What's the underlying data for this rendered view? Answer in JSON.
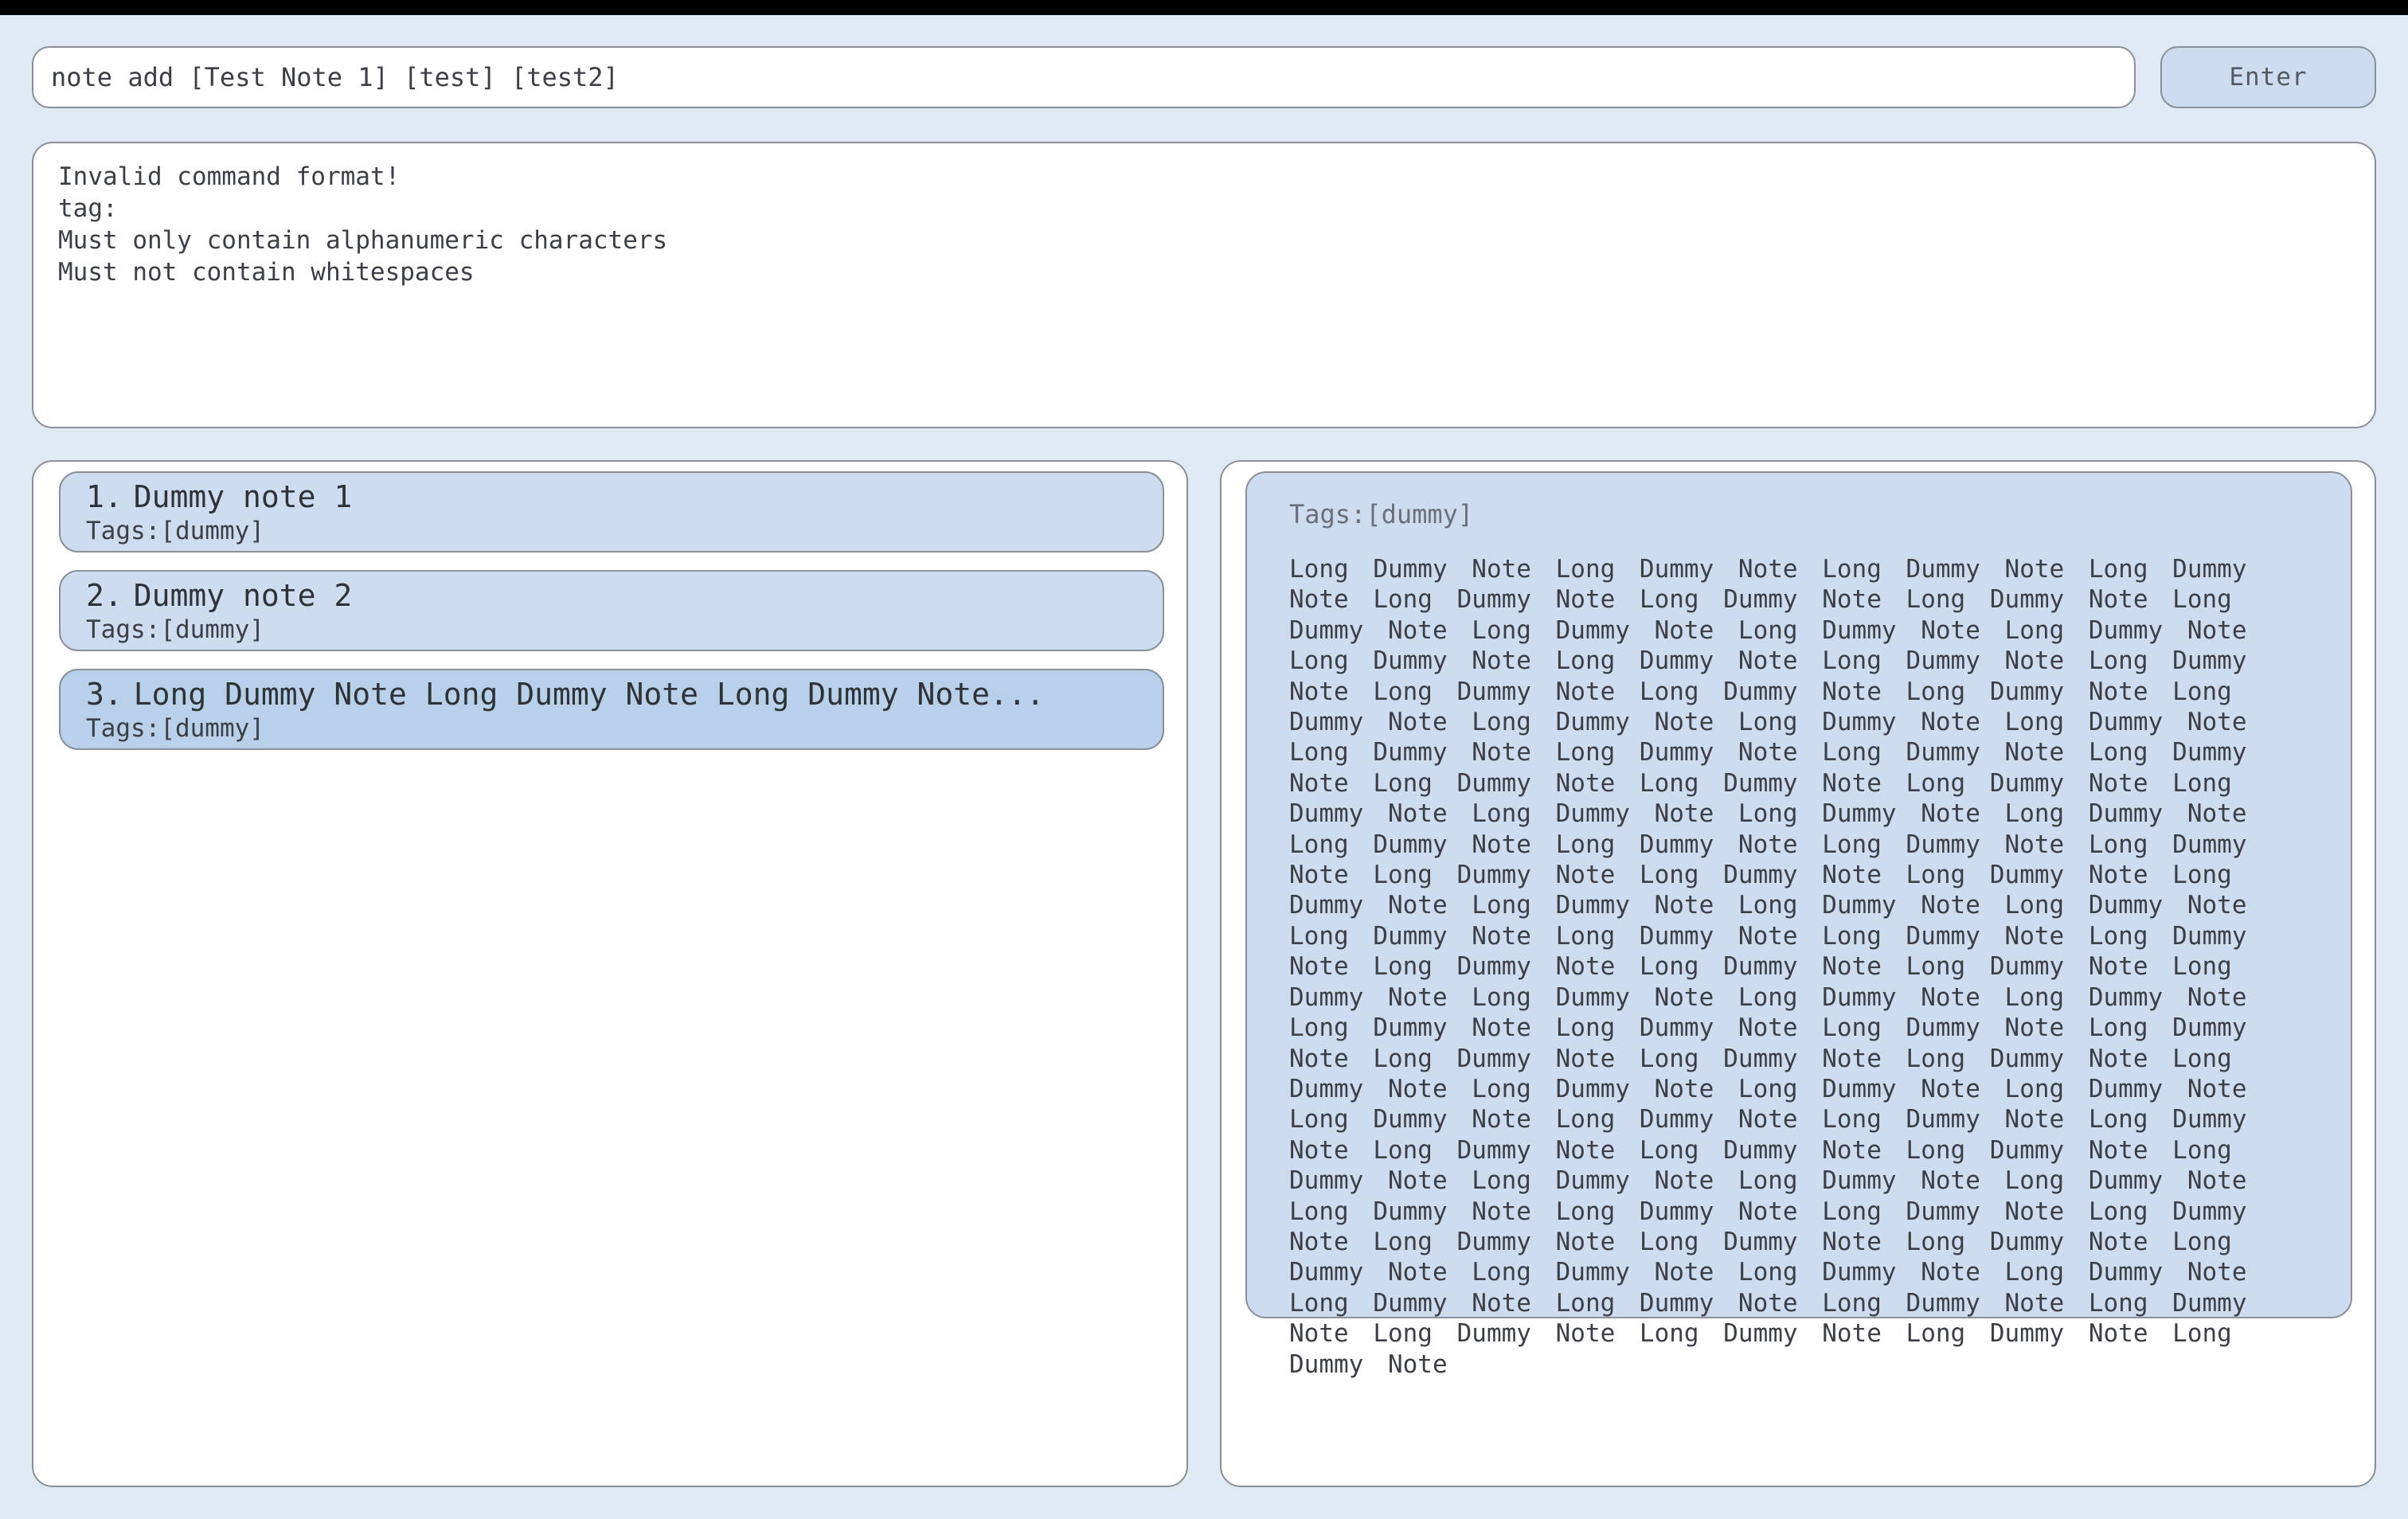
{
  "command_box": {
    "value": "note add [Test Note 1] [test] [test2]",
    "enter_label": "Enter"
  },
  "result": {
    "lines": [
      "Invalid command format!",
      "tag:",
      "Must only contain alphanumeric characters",
      "Must not contain whitespaces"
    ]
  },
  "note_list": {
    "items": [
      {
        "index": "1.",
        "title": "Dummy note 1",
        "tags": "Tags:[dummy]"
      },
      {
        "index": "2.",
        "title": "Dummy note 2",
        "tags": "Tags:[dummy]"
      },
      {
        "index": "3.",
        "title": "Long Dummy Note Long Dummy Note Long Dummy Note...",
        "tags": "Tags:[dummy]"
      }
    ],
    "selected_index": 2
  },
  "note_detail": {
    "tags": "Tags:[dummy]",
    "body": "Long Dummy Note Long Dummy Note Long Dummy Note Long Dummy Note Long Dummy Note Long Dummy Note Long Dummy Note Long Dummy Note Long Dummy Note Long Dummy Note Long Dummy Note Long Dummy Note Long Dummy Note Long Dummy Note Long Dummy Note Long Dummy Note Long Dummy Note Long Dummy Note Long Dummy Note Long Dummy Note Long Dummy Note Long Dummy Note Long Dummy Note Long Dummy Note Long Dummy Note Long Dummy Note Long Dummy Note Long Dummy Note Long Dummy Note Long Dummy Note Long Dummy Note Long Dummy Note Long Dummy Note Long Dummy Note Long Dummy Note Long Dummy Note Long Dummy Note Long Dummy Note Long Dummy Note Long Dummy Note Long Dummy Note Long Dummy Note Long Dummy Note Long Dummy Note Long Dummy Note Long Dummy Note Long Dummy Note Long Dummy Note Long Dummy Note Long Dummy Note Long Dummy Note Long Dummy Note Long Dummy Note Long Dummy Note Long Dummy Note Long Dummy Note Long Dummy Note Long Dummy Note Long Dummy Note Long Dummy Note Long Dummy Note Long Dummy Note Long Dummy Note Long Dummy Note Long Dummy Note Long Dummy Note Long Dummy Note Long Dummy Note Long Dummy Note Long Dummy Note Long Dummy Note Long Dummy Note Long Dummy Note Long Dummy Note Long Dummy Note Long Dummy Note Long Dummy Note Long Dummy Note Long Dummy Note Long Dummy Note Long Dummy Note Long Dummy Note Long Dummy Note Long Dummy Note Long Dummy Note Long Dummy Note Long Dummy Note Long Dummy Note Long Dummy Note Long Dummy Note Long Dummy Note Long Dummy Note Long Dummy Note Long Dummy Note Long Dummy Note Long Dummy Note"
  },
  "colors": {
    "background": "#dfe9f4",
    "card": "#cddcee",
    "card_selected": "#b8d0ea",
    "border": "#8a9099",
    "topbar": "#000000"
  }
}
